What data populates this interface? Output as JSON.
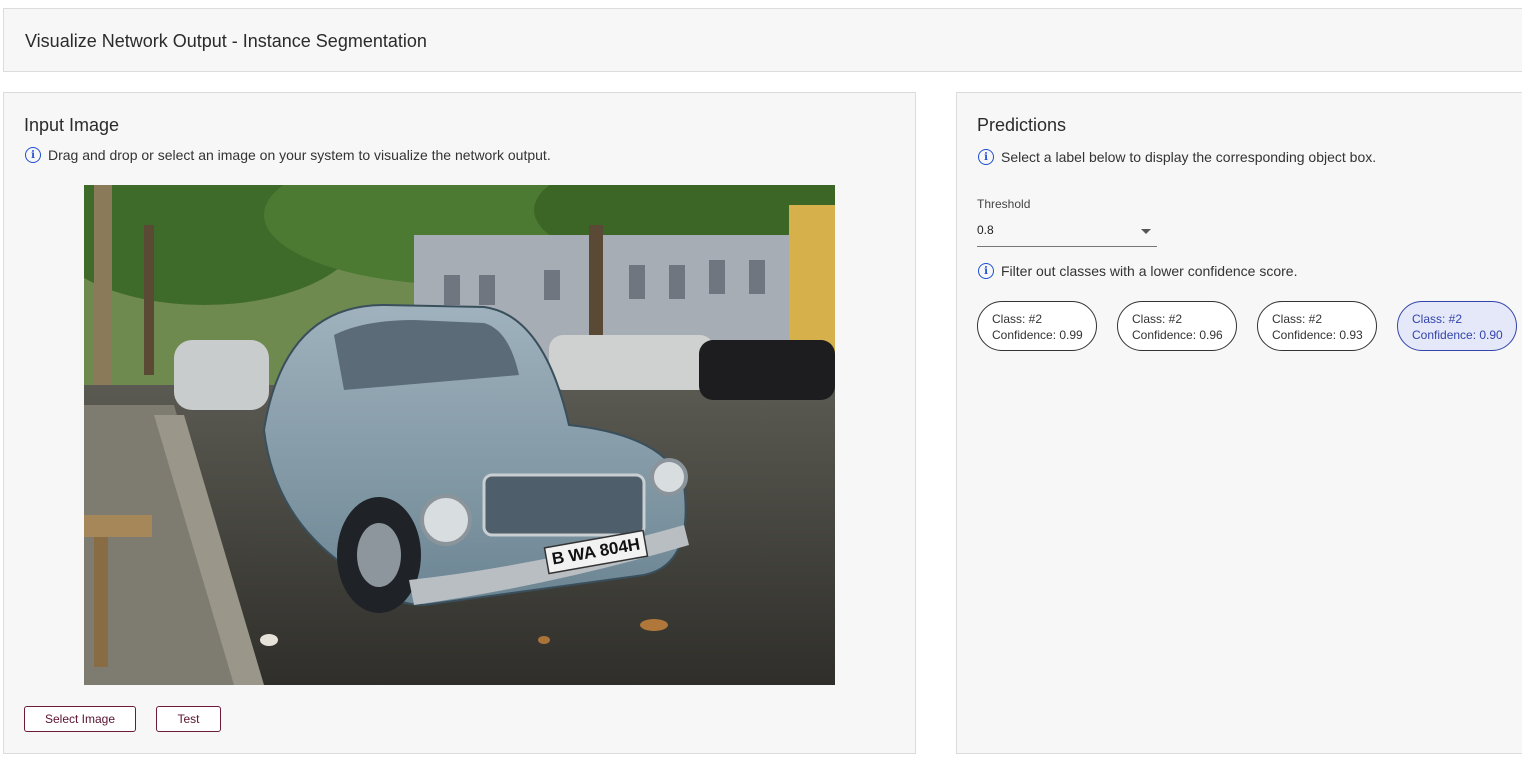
{
  "header": {
    "title": "Visualize Network Output - Instance Segmentation"
  },
  "input_panel": {
    "title": "Input Image",
    "info_text": "Drag and drop or select an image on your system to visualize the network output.",
    "license_plate": "B WA 804H",
    "buttons": {
      "select_image": "Select Image",
      "test": "Test"
    }
  },
  "predictions_panel": {
    "title": "Predictions",
    "info_text": "Select a label below to display the corresponding object box.",
    "threshold": {
      "label": "Threshold",
      "value": "0.8"
    },
    "filter_text": "Filter out classes with a lower confidence score.",
    "chips": [
      {
        "class": "Class: #2",
        "confidence": "Confidence: 0.99",
        "selected": false
      },
      {
        "class": "Class: #2",
        "confidence": "Confidence: 0.96",
        "selected": false
      },
      {
        "class": "Class: #2",
        "confidence": "Confidence: 0.93",
        "selected": false
      },
      {
        "class": "Class: #2",
        "confidence": "Confidence: 0.90",
        "selected": true
      }
    ]
  },
  "colors": {
    "accent_blue": "#1e4fd6",
    "button_maroon": "#6b1a3a",
    "selected_chip_bg": "#e4e8f8",
    "selected_chip_text": "#3344aa"
  },
  "icons": [
    "info-icon",
    "dropdown-caret-icon"
  ]
}
